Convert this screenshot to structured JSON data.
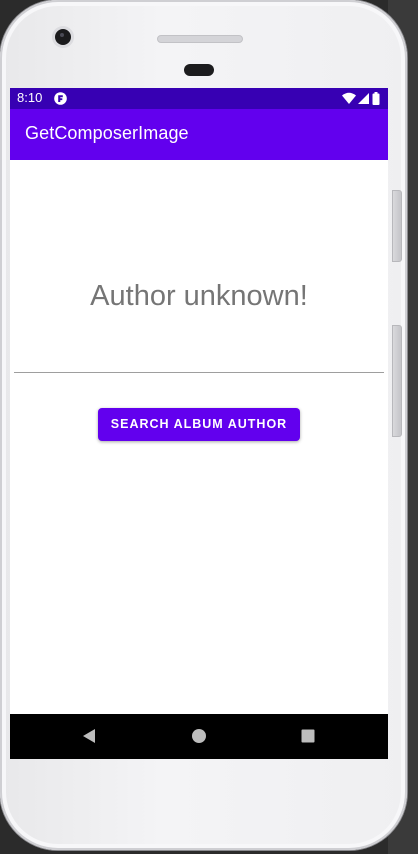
{
  "status_bar": {
    "time": "8:10",
    "app_icon": "app-notification-icon",
    "icons": [
      "wifi-icon",
      "signal-icon",
      "battery-icon"
    ],
    "color": "#3700b3"
  },
  "app_bar": {
    "title": "GetComposerImage",
    "color": "#6200ee"
  },
  "main": {
    "author_text": "Author unknown!",
    "search_button_label": "SEARCH ALBUM AUTHOR",
    "button_color": "#6200ee"
  },
  "nav_bar": {
    "buttons": [
      "back-icon",
      "home-icon",
      "recents-icon"
    ]
  }
}
